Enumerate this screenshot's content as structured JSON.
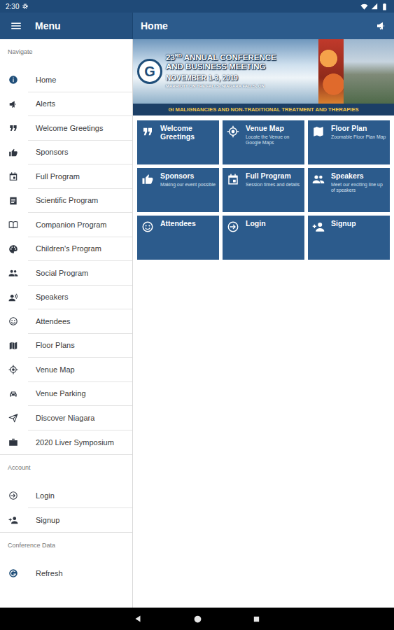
{
  "status_bar": {
    "time": "2:30"
  },
  "app_bar": {
    "menu_title": "Menu",
    "page_title": "Home"
  },
  "sidebar": {
    "sections": [
      {
        "title": "Navigate",
        "items": [
          {
            "label": "Home"
          },
          {
            "label": "Alerts"
          },
          {
            "label": "Welcome Greetings"
          },
          {
            "label": "Sponsors"
          },
          {
            "label": "Full Program"
          },
          {
            "label": "Scientific Program"
          },
          {
            "label": "Companion Program"
          },
          {
            "label": "Children's Program"
          },
          {
            "label": "Social Program"
          },
          {
            "label": "Speakers"
          },
          {
            "label": "Attendees"
          },
          {
            "label": "Floor Plans"
          },
          {
            "label": "Venue Map"
          },
          {
            "label": "Venue Parking"
          },
          {
            "label": "Discover Niagara"
          },
          {
            "label": "2020 Liver Symposium"
          }
        ]
      },
      {
        "title": "Account",
        "items": [
          {
            "label": "Login"
          },
          {
            "label": "Signup"
          }
        ]
      },
      {
        "title": "Conference Data",
        "items": [
          {
            "label": "Refresh"
          }
        ]
      }
    ]
  },
  "banner": {
    "logo": "G",
    "number": "23",
    "suffix": "RD",
    "title_line1": "ANNUAL CONFERENCE",
    "title_line2": "AND BUSINESS MEETING",
    "date": "NOVEMBER 1-3, 2019",
    "venue": "MARRIOTT ON THE FALLS, NIAGARA FALLS, ON",
    "theme": "GI MALIGNANCIES AND NON-TRADITIONAL TREATMENT AND THERAPIES"
  },
  "tiles": [
    {
      "title": "Welcome Greetings"
    },
    {
      "title": "Venue Map",
      "subtitle": "Locate the Venue on Google Maps"
    },
    {
      "title": "Floor Plan",
      "subtitle": "Zoomable Floor Plan Map"
    },
    {
      "title": "Sponsors",
      "subtitle": "Making our event possible"
    },
    {
      "title": "Full Program",
      "subtitle": "Session times and details"
    },
    {
      "title": "Speakers",
      "subtitle": "Meet our exciting line up of speakers"
    },
    {
      "title": "Attendees"
    },
    {
      "title": "Login"
    },
    {
      "title": "Signup"
    }
  ]
}
